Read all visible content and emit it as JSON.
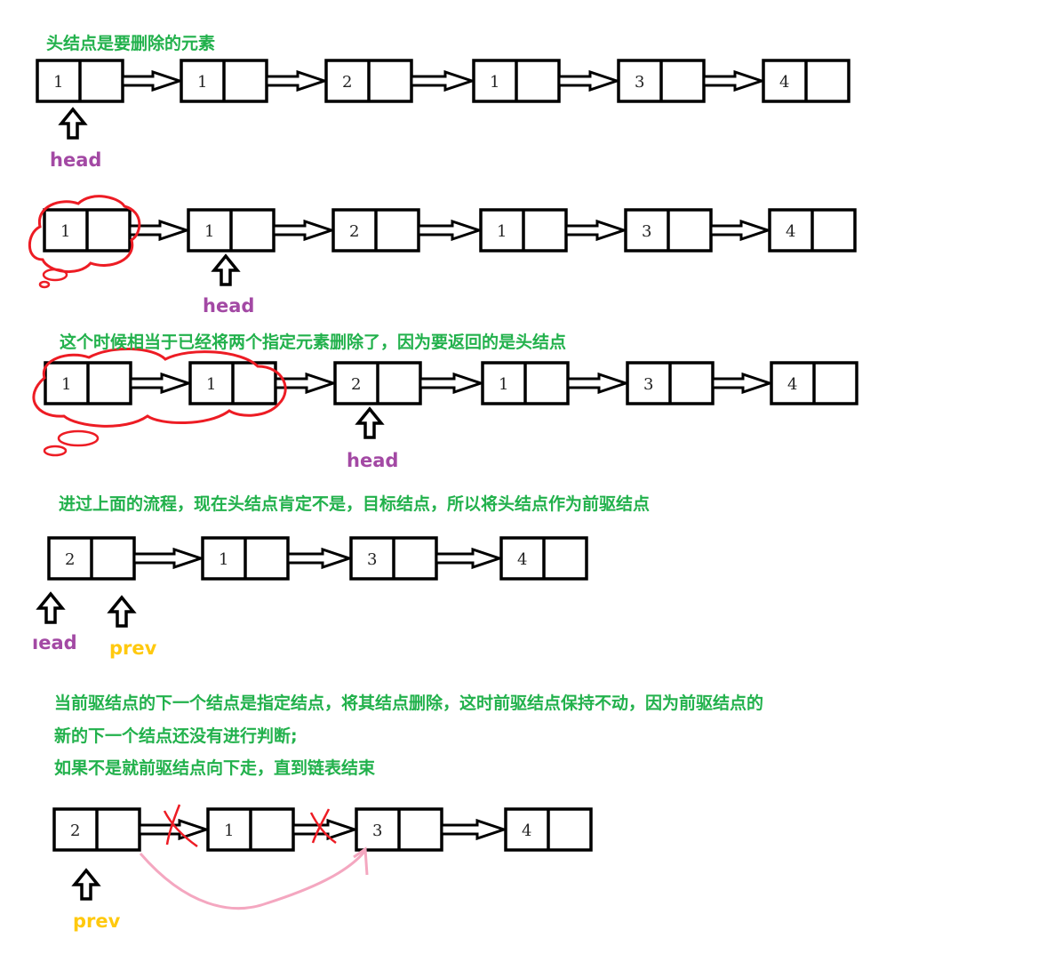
{
  "colors": {
    "caption": "#22b14c",
    "head": "#a349a4",
    "prev": "#ffc90e",
    "red": "#ed1c24",
    "pink": "#f4a7c0",
    "stroke": "#000000"
  },
  "captions": [
    "头结点是要删除的元素",
    "这个时候相当于已经将两个指定元素删除了，因为要返回的是头结点",
    "进过上面的流程，现在头结点肯定不是，目标结点，所以将头结点作为前驱结点",
    "当前驱结点的下一个结点是指定结点，将其结点删除，这时前驱结点保持不动，因为前驱结点的",
    "新的下一个结点还没有进行判断;",
    "如果不是就前驱结点向下走，直到链表结束"
  ],
  "rows": [
    {
      "values": [
        "1",
        "1",
        "2",
        "1",
        "3",
        "4"
      ]
    },
    {
      "values": [
        "1",
        "1",
        "2",
        "1",
        "3",
        "4"
      ]
    },
    {
      "values": [
        "1",
        "1",
        "2",
        "1",
        "3",
        "4"
      ]
    },
    {
      "values": [
        "2",
        "1",
        "3",
        "4"
      ]
    },
    {
      "values": [
        "2",
        "1",
        "3",
        "4"
      ]
    }
  ],
  "pointers": {
    "head": "head",
    "prev": "prev",
    "head_cropped": "ıead"
  }
}
